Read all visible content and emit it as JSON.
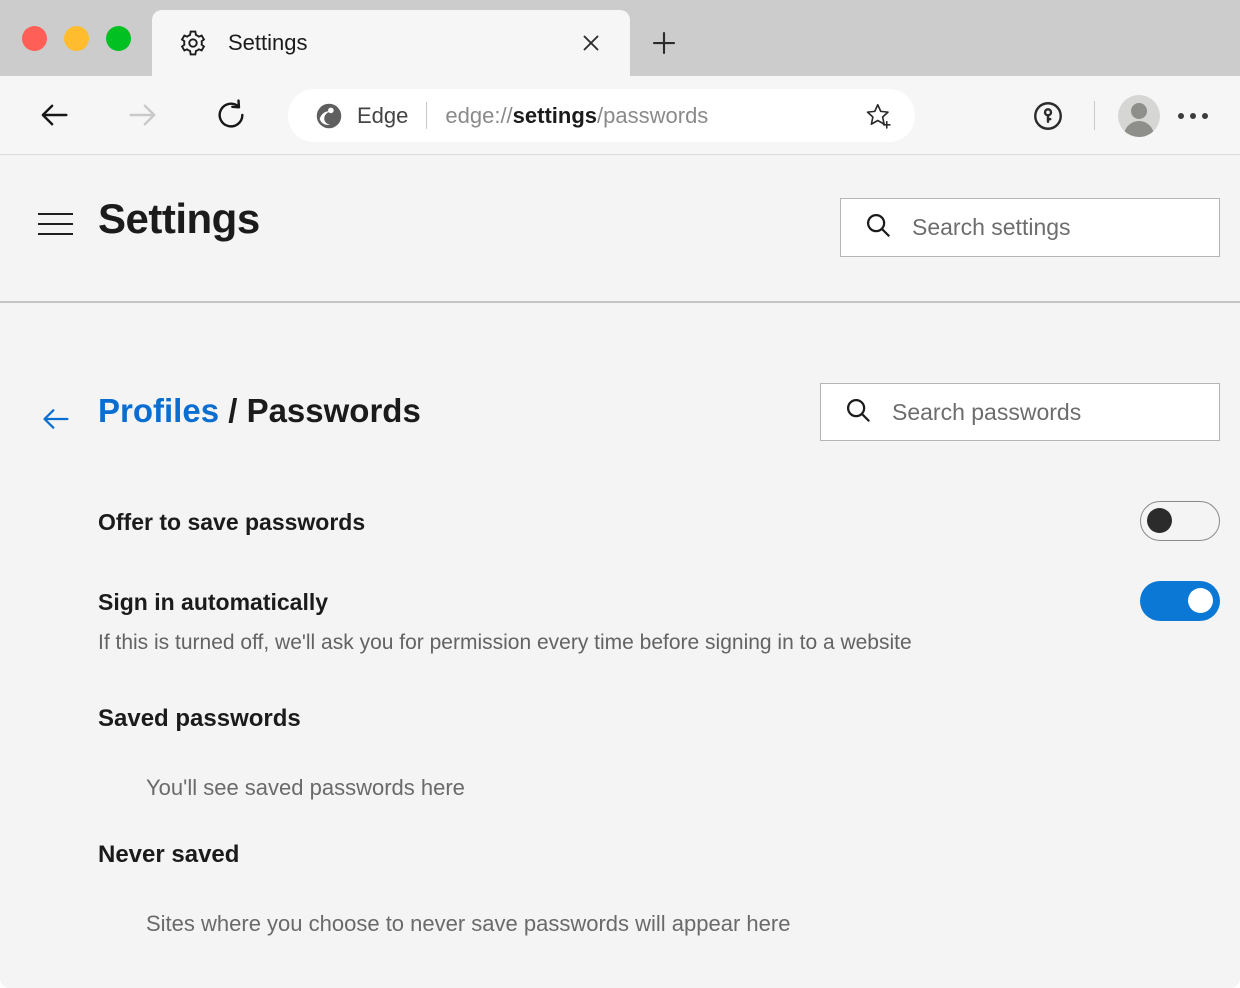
{
  "window": {
    "traffic_lights": [
      "close",
      "minimize",
      "maximize"
    ]
  },
  "tabstrip": {
    "tab": {
      "favicon": "gear-icon",
      "title": "Settings",
      "close_label": "×"
    },
    "new_tab_label": "+"
  },
  "toolbar": {
    "back": "←",
    "forward": "→",
    "reload": "↻",
    "omnibox": {
      "brand_label": "Edge",
      "url_prefix": "edge://",
      "url_bold": "settings",
      "url_suffix": "/passwords",
      "favorite_icon": "star-plus-icon"
    },
    "password_manager_icon": "key-circle-icon",
    "profile_icon": "avatar",
    "more_icon": "ellipsis-icon"
  },
  "settings_header": {
    "menu_icon": "hamburger-icon",
    "title": "Settings",
    "search": {
      "icon": "search-icon",
      "placeholder": "Search settings",
      "value": ""
    }
  },
  "page": {
    "back_icon": "arrow-left-icon",
    "breadcrumb": {
      "parent": "Profiles",
      "separator": " / ",
      "current": "Passwords"
    },
    "search": {
      "icon": "search-icon",
      "placeholder": "Search passwords",
      "value": ""
    },
    "settings": [
      {
        "label": "Offer to save passwords",
        "description": "",
        "toggle_state": "off"
      },
      {
        "label": "Sign in automatically",
        "description": "If this is turned off, we'll ask you for permission every time before signing in to a website",
        "toggle_state": "on"
      }
    ],
    "sections": [
      {
        "heading": "Saved passwords",
        "empty_text": "You'll see saved passwords here"
      },
      {
        "heading": "Never saved",
        "empty_text": "Sites where you choose to never save passwords will appear here"
      }
    ]
  },
  "colors": {
    "accent_blue": "#0a78d4",
    "link_blue": "#0a6ed1",
    "toolbar_bg": "#f6f6f6",
    "content_bg": "#f4f4f4",
    "tabstrip_bg": "#cccccc",
    "traffic_red": "#ff5f57",
    "traffic_yellow": "#febc2e",
    "traffic_green": "#00c022"
  }
}
